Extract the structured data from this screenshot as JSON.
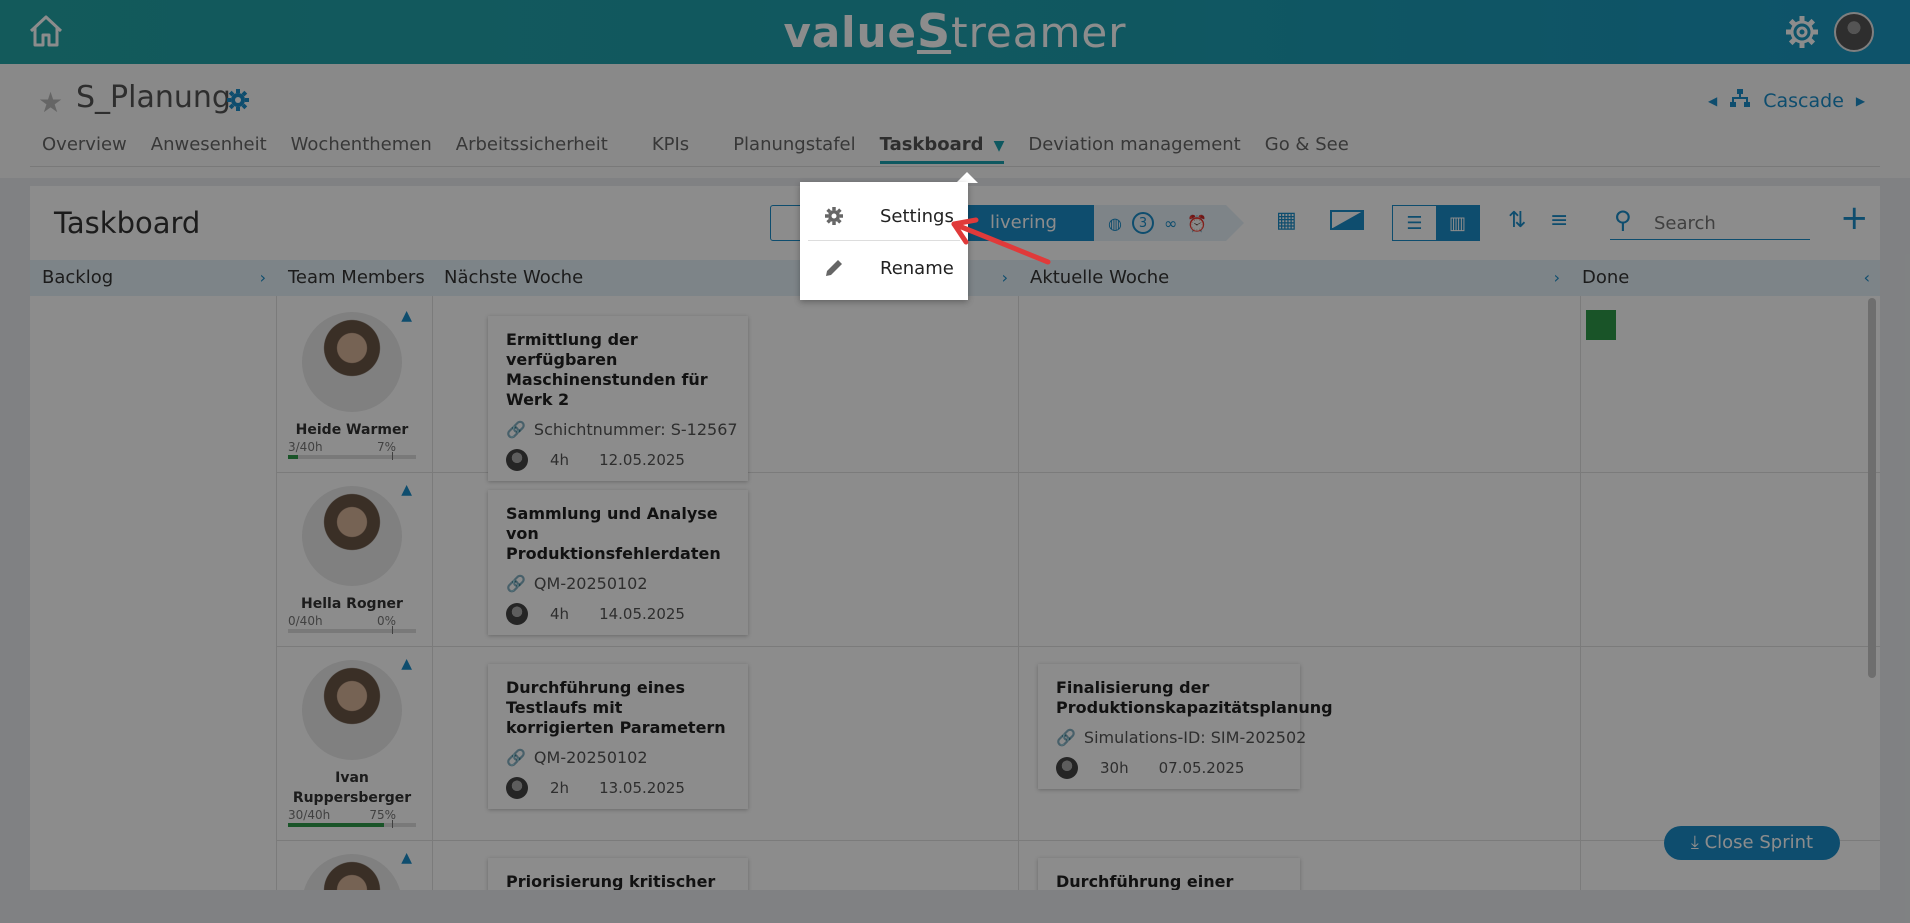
{
  "app": {
    "brand_value": "value",
    "brand_s": "S",
    "brand_rest": "treamer"
  },
  "page": {
    "title": "S_Planung",
    "cascade_label": "Cascade"
  },
  "tabs": [
    {
      "label": "Overview"
    },
    {
      "label": "Anwesenheit"
    },
    {
      "label": "Wochenthemen"
    },
    {
      "label": "Arbeitssicherheit"
    },
    {
      "label": "KPIs"
    },
    {
      "label": "Planungstafel"
    },
    {
      "label": "Taskboard",
      "active": true
    },
    {
      "label": "Deviation management"
    },
    {
      "label": "Go & See"
    }
  ],
  "board": {
    "title": "Taskboard",
    "primary_button_label": "livering",
    "status_count": "3",
    "search_placeholder": "Search",
    "close_sprint_label": "Close Sprint"
  },
  "columns": [
    {
      "label": "Backlog"
    },
    {
      "label": "Team Members"
    },
    {
      "label": "Nächste Woche"
    },
    {
      "label": "Aktuelle Woche"
    },
    {
      "label": "Done"
    }
  ],
  "members": [
    {
      "name": "Heide Warmer",
      "hours": "3/40h",
      "percent": "7%",
      "load": 0.075
    },
    {
      "name": "Hella Rogner",
      "hours": "0/40h",
      "percent": "0%",
      "load": 0
    },
    {
      "name": "Ivan Ruppersberger",
      "hours": "30/40h",
      "percent": "75%",
      "load": 0.75
    },
    {
      "name": "",
      "hours": "",
      "percent": "",
      "load": 0
    }
  ],
  "cards": [
    {
      "title": "Ermittlung der verfügbaren Maschinenstunden für Werk 2",
      "ref": "Schichtnummer: S-12567",
      "hours": "4h",
      "date": "12.05.2025"
    },
    {
      "title": "Sammlung und Analyse von Produktionsfehlerdaten",
      "ref": "QM-20250102",
      "hours": "4h",
      "date": "14.05.2025"
    },
    {
      "title": "Durchführung eines Testlaufs mit korrigierten Parametern",
      "ref": "QM-20250102",
      "hours": "2h",
      "date": "13.05.2025"
    },
    {
      "title": "Finalisierung der Produktionskapazitätsplanung",
      "ref": "Simulations-ID: SIM-202502",
      "hours": "30h",
      "date": "07.05.2025"
    },
    {
      "title": "Priorisierung kritischer",
      "ref": "",
      "hours": "",
      "date": ""
    },
    {
      "title": "Durchführung einer",
      "ref": "",
      "hours": "",
      "date": ""
    }
  ],
  "menu": {
    "settings_label": "Settings",
    "rename_label": "Rename"
  },
  "colors": {
    "topbar": "#1e9fb0",
    "accent": "#1a8cc8",
    "progress": "#2e9a4a",
    "annotation_arrow": "#e03a3a"
  }
}
